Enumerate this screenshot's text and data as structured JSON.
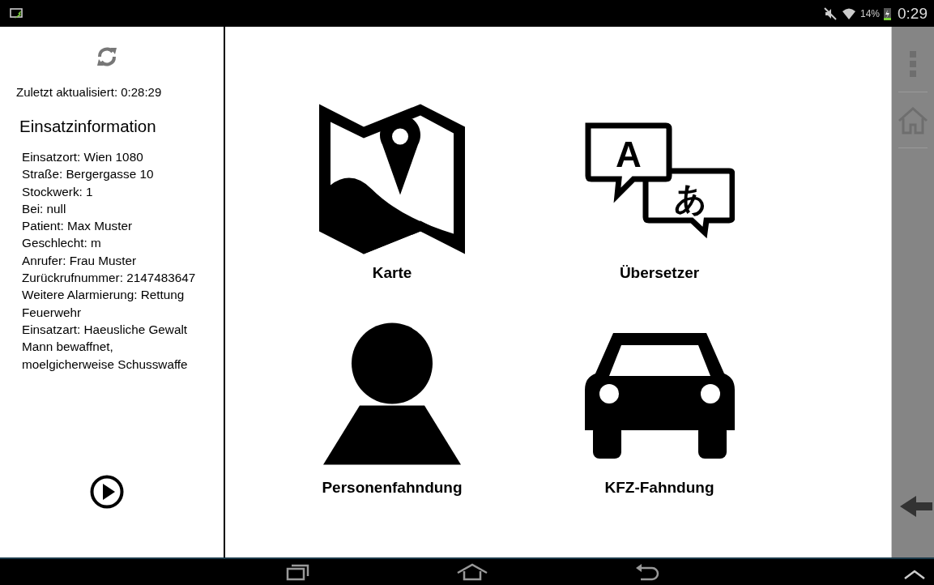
{
  "status_bar": {
    "battery_percent": "14%",
    "time": "0:29"
  },
  "sidebar": {
    "last_updated": "Zuletzt aktualisiert:  0:28:29",
    "heading": "Einsatzinformation",
    "lines": [
      "Einsatzort: Wien 1080",
      "Straße: Bergergasse 10",
      "Stockwerk: 1",
      "Bei: null",
      "Patient: Max Muster",
      "Geschlecht: m",
      "Anrufer: Frau Muster",
      "Zurückrufnummer: 2147483647",
      "Weitere Alarmierung: Rettung",
      "Feuerwehr",
      "Einsatzart: Haeusliche Gewalt",
      "Mann bewaffnet,",
      "moelgicherweise Schusswaffe"
    ]
  },
  "tiles": [
    {
      "kind": "map",
      "label": "Karte"
    },
    {
      "kind": "translate",
      "label": "Übersetzer"
    },
    {
      "kind": "person",
      "label": "Personenfahndung"
    },
    {
      "kind": "car",
      "label": "KFZ-Fahndung"
    }
  ],
  "translator_icon_letters": {
    "latin": "A",
    "kana": "あ"
  }
}
